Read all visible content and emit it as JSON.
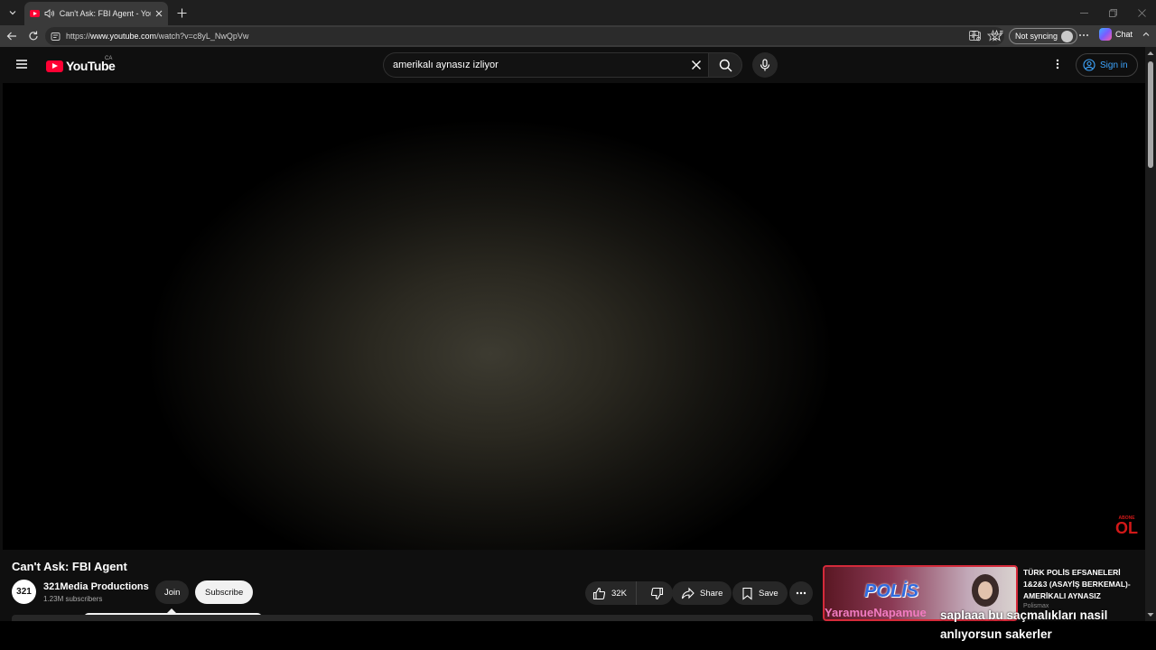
{
  "browser": {
    "tab_title": "Can't Ask: FBI Agent - YouTube",
    "url_prefix": "https://",
    "url_domain": "www.youtube.com",
    "url_path": "/watch?v=c8yL_NwQpVw",
    "sync_label": "Not syncing",
    "chat_label": "Chat"
  },
  "masthead": {
    "logo_text": "YouTube",
    "country_code": "CA",
    "search_query": "amerikalı aynasız izliyor",
    "signin_label": "Sign in"
  },
  "player": {
    "watermark_top": "ABONE",
    "watermark_main": "OL"
  },
  "video": {
    "title": "Can't Ask: FBI Agent",
    "channel_avatar_text": "321",
    "channel_name": "321Media Productions",
    "subscribers": "1.23M subscribers",
    "join_label": "Join",
    "subscribe_label": "Subscribe",
    "likes": "32K",
    "share_label": "Share",
    "save_label": "Save"
  },
  "recommendation": {
    "thumb_text": "POLİS",
    "title": "TÜRK POLİS EFSANELERİ 1&2&3 (ASAYİŞ BERKEMAL)- AMERİKALI AYNASIZ",
    "channel": "Polismax"
  },
  "chat_overlay": {
    "username": "YaramueNapamue",
    "message": "saplaaa bu saçmalıkları nasil anlıyorsun sakerler"
  },
  "colors": {
    "brand_red": "#ff0033",
    "link_blue": "#3ea6ff",
    "chat_user_pink": "#f07bc0"
  }
}
